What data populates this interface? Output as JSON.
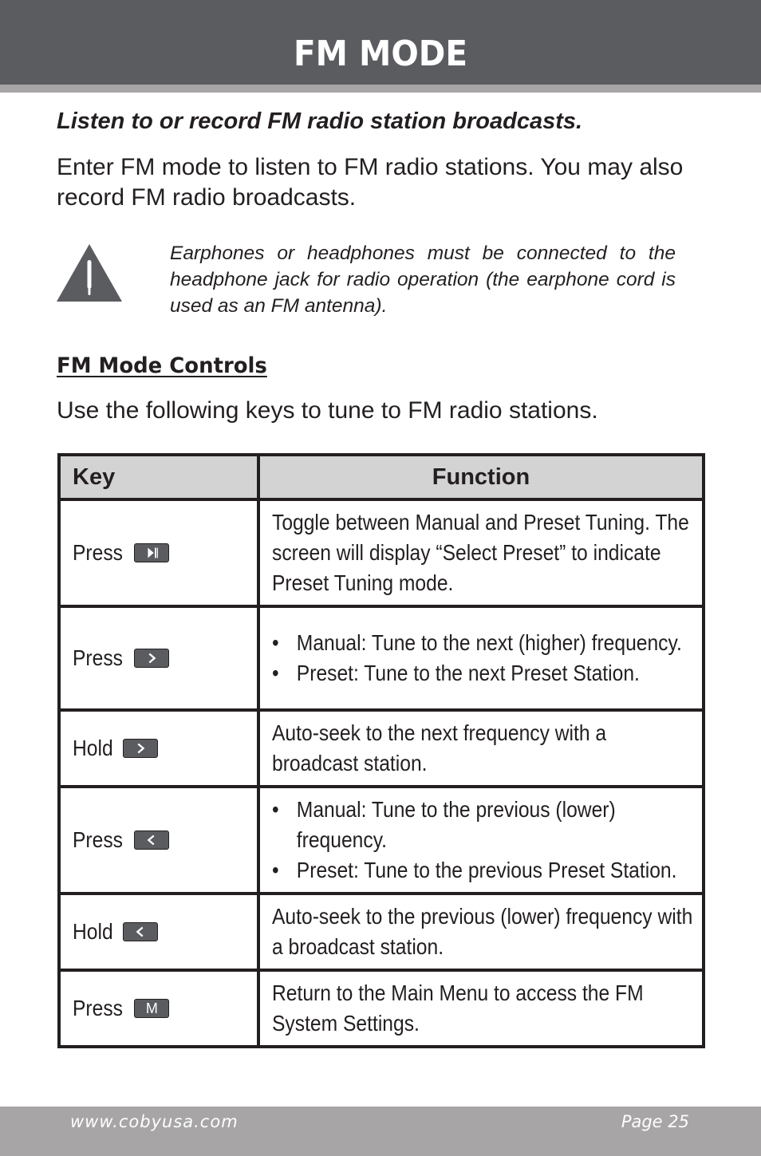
{
  "header": {
    "title": "FM MODE"
  },
  "subtitle": "Listen to or record FM radio station broadcasts.",
  "intro": "Enter FM mode to listen to FM radio stations. You may also record FM radio broadcasts.",
  "warning": {
    "icon": "warning-triangle-icon",
    "text": "Earphones or headphones must be connected to the headphone jack for radio operation (the earphone cord is used as an FM antenna)."
  },
  "controls_section": {
    "heading": "FM Mode Controls",
    "intro": "Use the following keys to tune to FM radio stations.",
    "table": {
      "headers": {
        "key": "Key",
        "function": "Function"
      },
      "rows": [
        {
          "action": "Press",
          "key_icon": "play-pause-key",
          "function": "Toggle between Manual and Preset Tuning. The screen will display “Select Preset” to indicate Preset Tuning mode."
        },
        {
          "action": "Press",
          "key_icon": "next-key",
          "bullets": [
            "Manual: Tune to the next (higher) frequency.",
            "Preset: Tune to the next Preset Station."
          ]
        },
        {
          "action": "Hold",
          "key_icon": "next-key",
          "function": "Auto-seek to the next frequency with a broadcast station."
        },
        {
          "action": "Press",
          "key_icon": "previous-key",
          "bullets": [
            "Manual: Tune to the previous (lower) frequency.",
            "Preset: Tune to the previous Preset Station."
          ]
        },
        {
          "action": "Hold",
          "key_icon": "previous-key",
          "function": "Auto-seek to the previous (lower) frequency with a broadcast station."
        },
        {
          "action": "Press",
          "key_icon": "menu-key",
          "key_letter": "M",
          "function": "Return to the Main Menu to access the FM System Settings."
        }
      ]
    }
  },
  "footer": {
    "url": "www.cobyusa.com",
    "page": "Page 25"
  },
  "colors": {
    "header_bg": "#5a5c60",
    "stripe": "#a7a5a6",
    "table_header_bg": "#d4d3d3",
    "text": "#231f20"
  }
}
